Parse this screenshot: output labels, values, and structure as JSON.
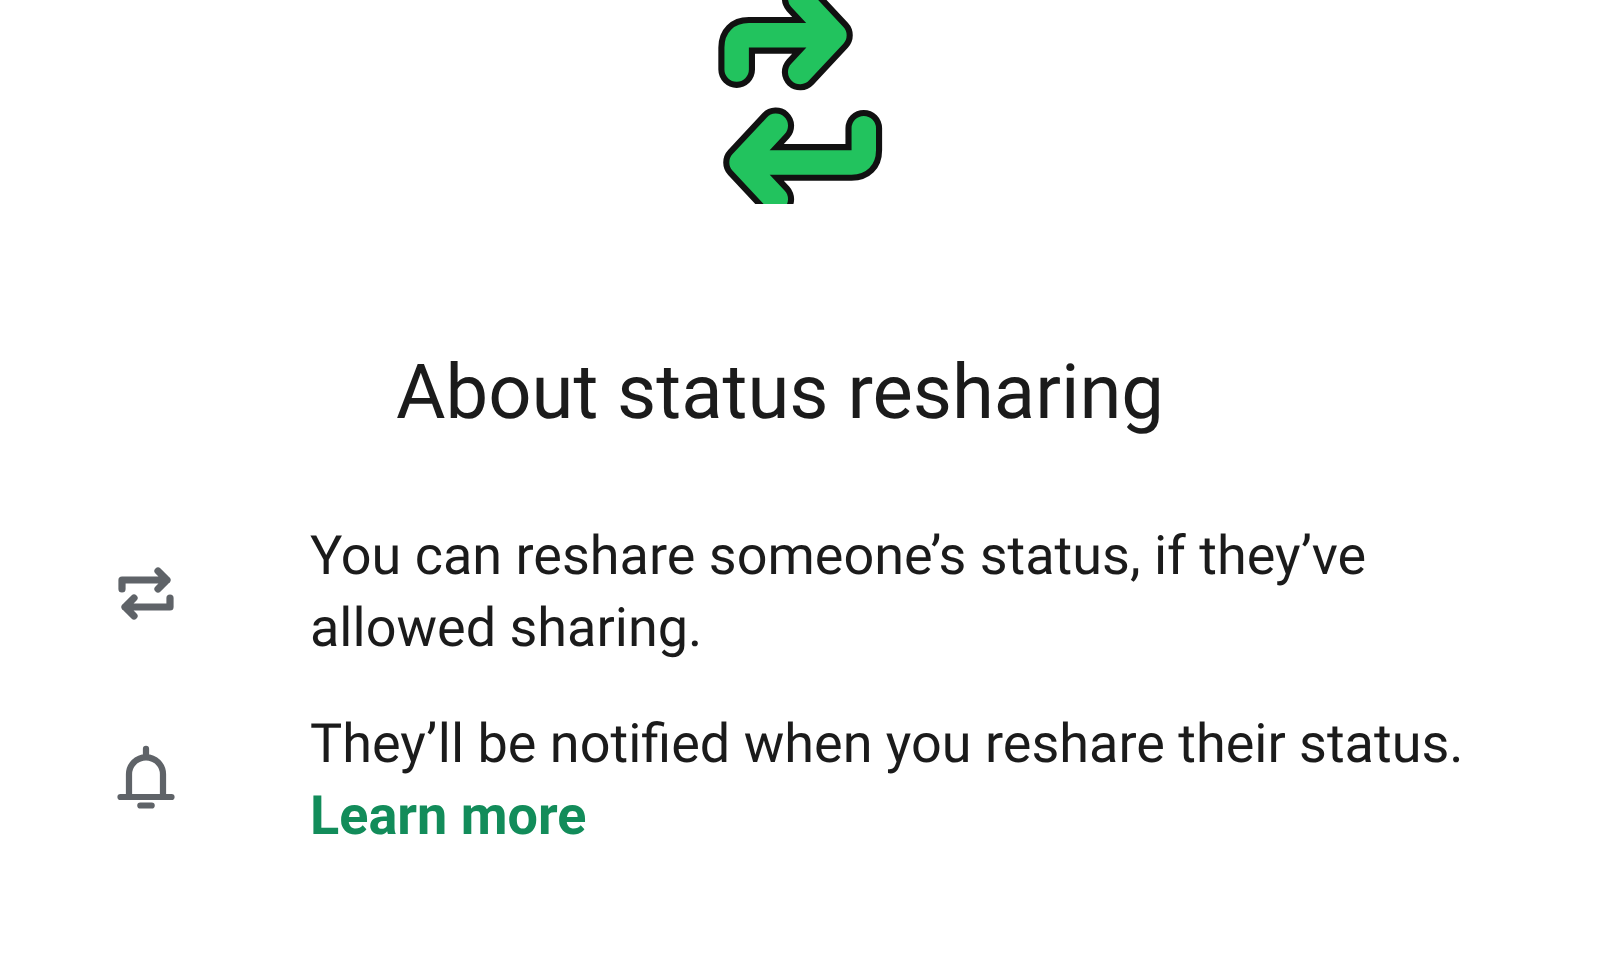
{
  "title": "About status resharing",
  "items": [
    {
      "kind": "repeat",
      "text": "You can reshare someone’s status, if they’ve allowed sharing."
    },
    {
      "kind": "bell",
      "text": "They’ll be notified when you reshare their status.",
      "link": "Learn more"
    }
  ]
}
